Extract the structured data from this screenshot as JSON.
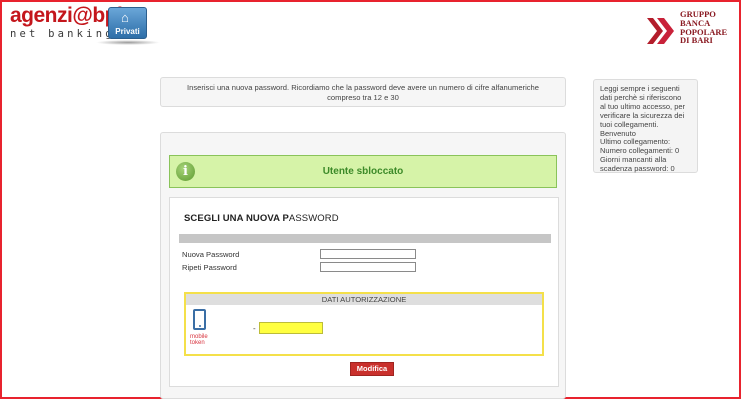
{
  "brand": {
    "logo_name": "agenzi@bpb",
    "logo_tagline": "net banking",
    "section_button": "Privati",
    "bank_name_lines": [
      "GRUPPO",
      "BANCA",
      "POPOLARE",
      "DI BARI"
    ],
    "colors": {
      "brand_red": "#c4161c",
      "frame_red": "#e8232e",
      "success_green": "#3c8a28",
      "success_bg": "#d6f3a8",
      "otp_yellow": "#ffff40"
    }
  },
  "notice": {
    "line1": "Inserisci una nuova password. Ricordiamo che la password deve avere un numero di cifre alfanumeriche",
    "line2": "compreso tra 12 e 30"
  },
  "side_panel": {
    "lines": [
      "Leggi sempre i seguenti",
      "dati perchè si riferiscono",
      "al tuo ultimo accesso, per",
      "verificare la sicurezza dei",
      "tuoi collegamenti.",
      "Benvenuto",
      "Ultimo collegamento:",
      "Numero collegamenti: 0",
      "Giorni mancanti alla",
      "scadenza password: 0"
    ]
  },
  "status": {
    "icon": "info-icon",
    "message": "Utente sbloccato"
  },
  "form": {
    "title_bold": "SCEGLI UNA NUOVA P",
    "title_rest": "ASSWORD",
    "new_password_label": "Nuova Password",
    "new_password_value": "",
    "repeat_password_label": "Ripeti Password",
    "repeat_password_value": "",
    "auth_header": "DATI AUTORIZZAZIONE",
    "token_label_1": "mobile",
    "token_label_2": "token",
    "otp_separator": "-",
    "otp_value": "",
    "submit_label": "Modifica"
  }
}
